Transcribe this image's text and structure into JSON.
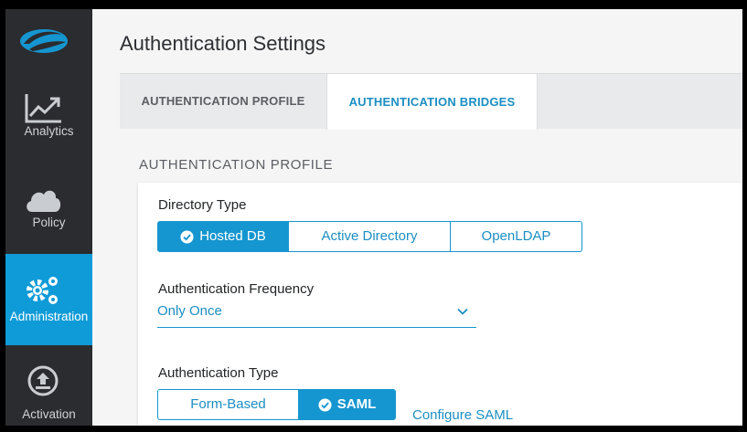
{
  "colors": {
    "accent": "#1596d0",
    "sidebar": "#2b2c2f",
    "sidebar_active": "#0f9bd7"
  },
  "sidebar": {
    "items": [
      {
        "label": "Analytics",
        "icon": "chart-line-icon"
      },
      {
        "label": "Policy",
        "icon": "cloud-icon"
      },
      {
        "label": "Administration",
        "icon": "gears-icon",
        "active": true
      },
      {
        "label": "Activation",
        "icon": "upload-icon"
      }
    ]
  },
  "page": {
    "title": "Authentication Settings"
  },
  "tabs": [
    {
      "label": "AUTHENTICATION PROFILE",
      "active": false
    },
    {
      "label": "AUTHENTICATION BRIDGES",
      "active": true
    }
  ],
  "section": {
    "title": "AUTHENTICATION PROFILE"
  },
  "directory_type": {
    "label": "Directory Type",
    "options": [
      "Hosted DB",
      "Active Directory",
      "OpenLDAP"
    ],
    "selected": "Hosted DB"
  },
  "auth_frequency": {
    "label": "Authentication Frequency",
    "value": "Only Once"
  },
  "auth_type": {
    "label": "Authentication Type",
    "options": [
      "Form-Based",
      "SAML"
    ],
    "selected": "SAML",
    "configure_link": "Configure SAML"
  }
}
